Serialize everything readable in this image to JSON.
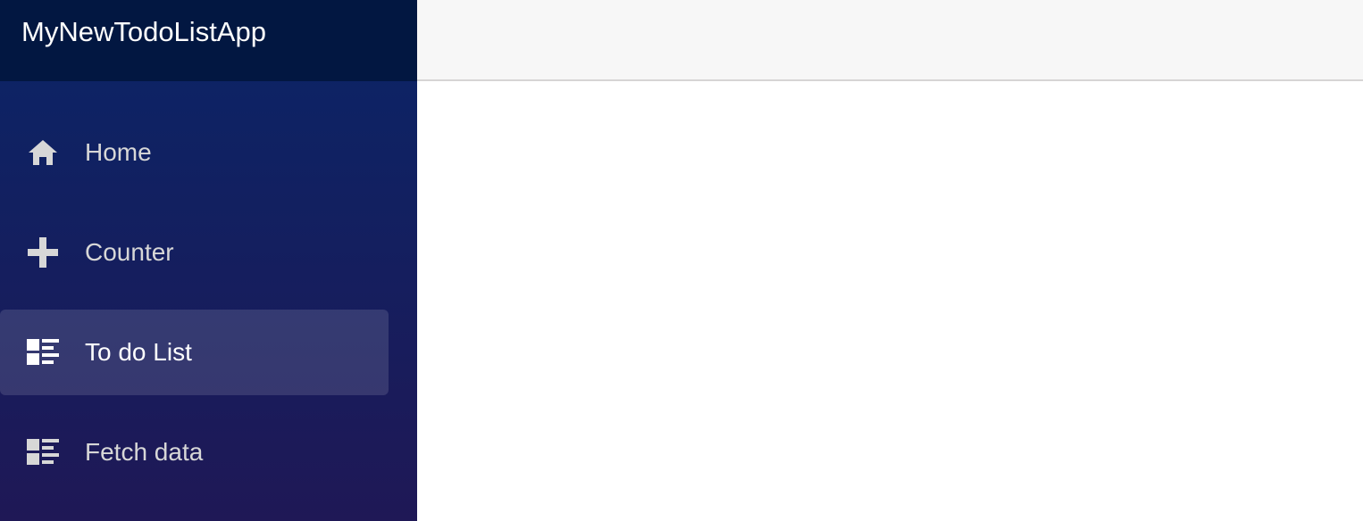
{
  "app": {
    "brand": "MyNewTodoListApp"
  },
  "nav": {
    "items": [
      {
        "label": "Home",
        "icon": "home-icon"
      },
      {
        "label": "Counter",
        "icon": "plus-icon"
      },
      {
        "label": "To do List",
        "icon": "list-rich-icon",
        "active": true
      },
      {
        "label": "Fetch data",
        "icon": "list-rich-icon"
      }
    ]
  },
  "colors": {
    "brand_bar": "#021741",
    "sidebar_top": "#0a2567",
    "sidebar_bottom": "#1f1856",
    "top_row": "#f7f7f7",
    "nav_text": "#d7d7d7"
  }
}
